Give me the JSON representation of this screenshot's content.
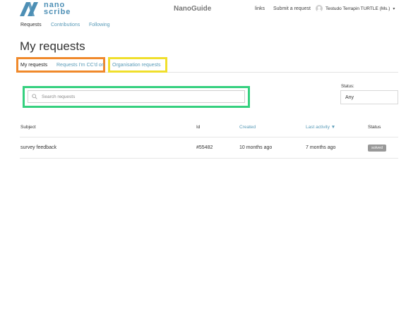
{
  "header": {
    "logo_lines": [
      "nano",
      "scribe"
    ],
    "site_title": "NanoGuide",
    "links_label": "links",
    "submit_label": "Submit a request",
    "user_name": "Testudo Terrapin TURTLE (Ms.)",
    "caret": "▾"
  },
  "subnav": [
    {
      "label": "Requests",
      "active": true
    },
    {
      "label": "Contributions",
      "active": false
    },
    {
      "label": "Following",
      "active": false
    }
  ],
  "page_title": "My requests",
  "tabs": [
    {
      "label": "My requests",
      "active": true
    },
    {
      "label": "Requests I'm CC'd on",
      "active": false
    },
    {
      "label": "Organisation requests",
      "active": false
    }
  ],
  "search": {
    "placeholder": "Search requests",
    "value": ""
  },
  "status_filter": {
    "label": "Status:",
    "value": "Any"
  },
  "table": {
    "columns": [
      "Subject",
      "Id",
      "Created",
      "Last activity ▼",
      "Status"
    ],
    "rows": [
      {
        "subject": "survey feedback",
        "id": "#55482",
        "created": "10 months ago",
        "last_activity": "7 months ago",
        "status": "solved"
      }
    ]
  },
  "colors": {
    "accent": "#5a9bb8",
    "highlight_orange": "#f0892b",
    "highlight_yellow": "#f0df2c",
    "highlight_green": "#35d07f",
    "badge": "#999999"
  },
  "icons": {
    "logo": "nanoscribe-logo-icon",
    "search": "search-icon",
    "user": "user-avatar-icon",
    "caret": "chevron-down-icon"
  }
}
